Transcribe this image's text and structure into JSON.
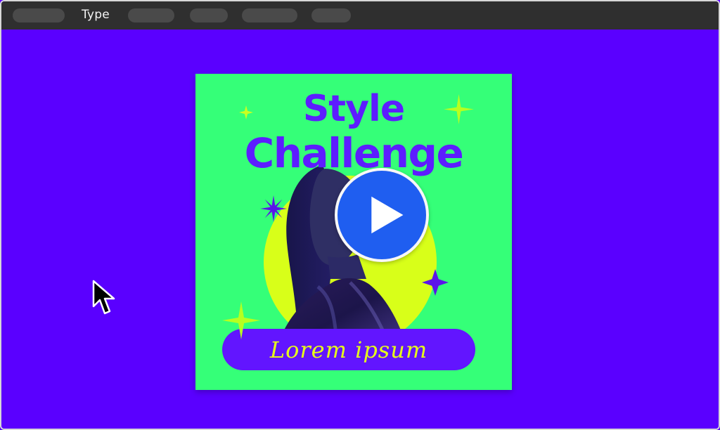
{
  "topbar": {
    "label": "Type"
  },
  "card": {
    "headline_line1": "Style",
    "headline_line2": "Challenge",
    "caption": "Lorem ipsum"
  },
  "colors": {
    "workspace": "#5a00ff",
    "card_bg": "#35ff78",
    "headline": "#5d1dff",
    "circle": "#d8ff19",
    "lozenge": "#6215ff",
    "caption": "#e7ff18",
    "play": "#1f5ef0"
  },
  "icons": {
    "play": "play-icon",
    "cursor": "cursor-icon",
    "spark": "sparkle-icon"
  }
}
